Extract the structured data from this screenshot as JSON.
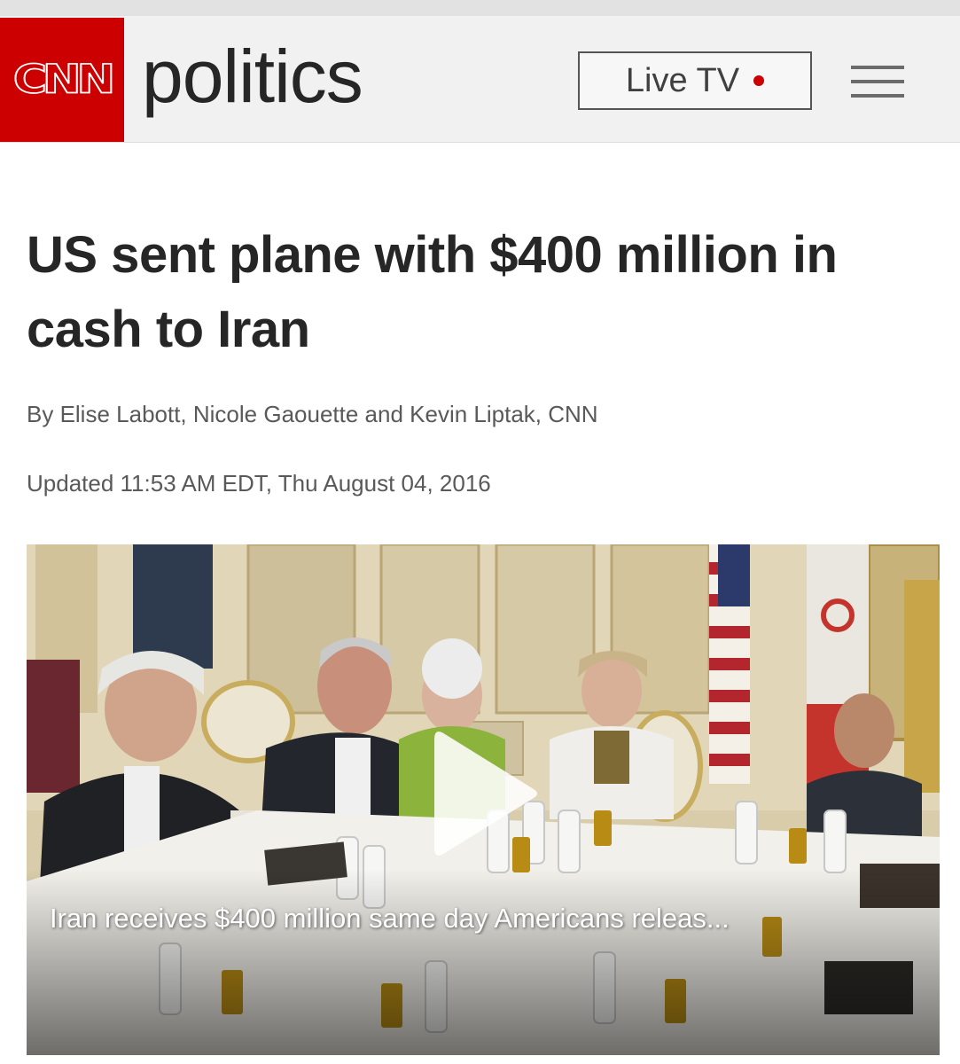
{
  "header": {
    "logo_text": "CNN",
    "section": "politics",
    "live_tv_label": "Live TV",
    "brand_color": "#cc0000",
    "menu_icon": "hamburger-menu-icon"
  },
  "article": {
    "headline": "US sent plane with $400 million in cash to Iran",
    "byline": "By Elise Labott, Nicole Gaouette and Kevin Liptak, CNN",
    "updated": "Updated 11:53 AM EDT, Thu August 04, 2016"
  },
  "video": {
    "caption": "Iran receives $400 million same day Americans releas...",
    "play_icon": "play-icon"
  }
}
